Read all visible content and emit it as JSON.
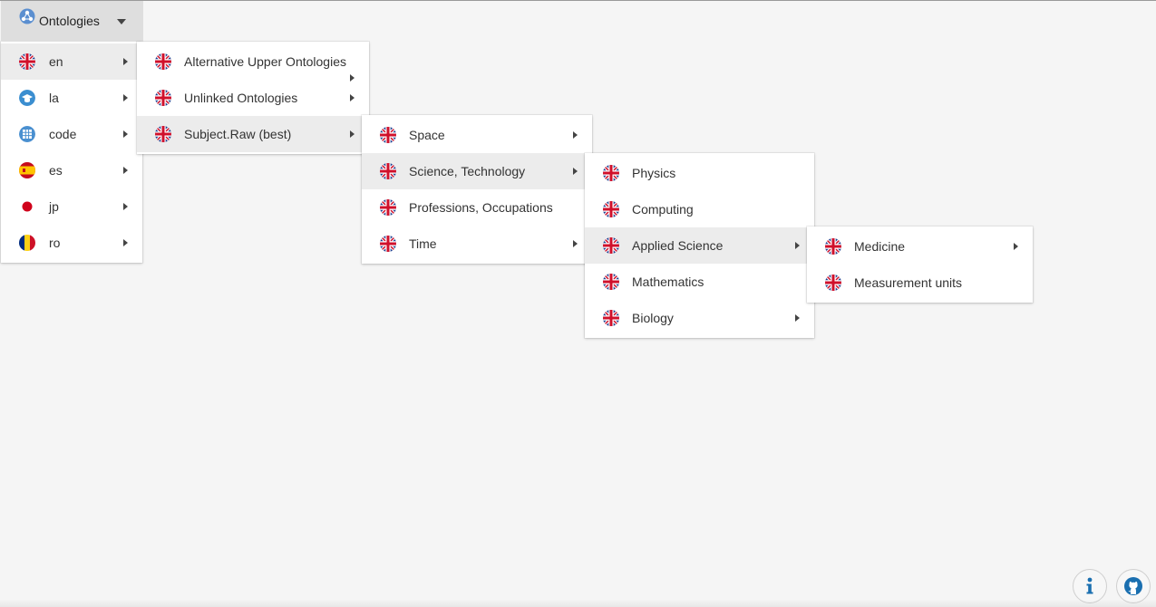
{
  "topbar": {
    "title": "Ontologies"
  },
  "languages": [
    {
      "code": "en",
      "flag": "uk-flag-icon"
    },
    {
      "code": "la",
      "flag": "graduation-cap-icon"
    },
    {
      "code": "code",
      "flag": "code-grid-icon"
    },
    {
      "code": "es",
      "flag": "spain-flag-icon"
    },
    {
      "code": "jp",
      "flag": "japan-flag-icon"
    },
    {
      "code": "ro",
      "flag": "romania-flag-icon"
    }
  ],
  "en_menu": [
    {
      "label": "Alternative Upper Ontologies"
    },
    {
      "label": "Unlinked Ontologies"
    },
    {
      "label": "Subject.Raw (best)"
    }
  ],
  "subject_menu": [
    {
      "label": "Space"
    },
    {
      "label": "Science, Technology"
    },
    {
      "label": "Professions, Occupations"
    },
    {
      "label": "Time"
    }
  ],
  "science_menu": [
    {
      "label": "Physics"
    },
    {
      "label": "Computing"
    },
    {
      "label": "Applied Science"
    },
    {
      "label": "Mathematics"
    },
    {
      "label": "Biology"
    }
  ],
  "applied_menu": [
    {
      "label": "Medicine"
    },
    {
      "label": "Measurement units"
    }
  ],
  "footer": {
    "info_icon": "info-icon",
    "github_icon": "github-icon"
  },
  "colors": {
    "uk_blue": "#1f3f8f",
    "uk_red": "#d0102b",
    "topbar_bg": "#dedede",
    "active_bg": "#ececec"
  }
}
